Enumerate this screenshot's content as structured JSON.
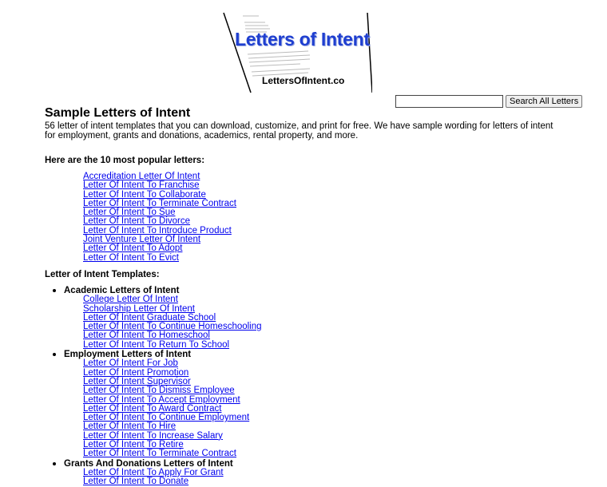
{
  "banner": {
    "title": "Letters of Intent",
    "site": "LettersOfIntent.co"
  },
  "search": {
    "value": "",
    "button_label": "Search All Letters"
  },
  "page": {
    "title": "Sample Letters of Intent",
    "intro": "56 letter of intent templates that you can download, customize, and print for free. We have sample wording for letters of intent for employment, grants and donations, academics, rental property, and more.",
    "popular_heading": "Here are the 10 most popular letters:",
    "templates_heading": "Letter of Intent Templates:"
  },
  "popular": [
    "Accreditation Letter Of Intent",
    "Letter Of Intent To Franchise",
    "Letter Of Intent To Collaborate",
    "Letter Of Intent To Terminate Contract",
    "Letter Of Intent To Sue",
    "Letter Of Intent To Divorce",
    "Letter Of Intent To Introduce Product",
    "Joint Venture Letter Of Intent",
    "Letter Of Intent To Adopt",
    "Letter Of Intent To Evict"
  ],
  "categories": [
    {
      "name": "Academic Letters of Intent",
      "items": [
        "College Letter Of Intent",
        "Scholarship Letter Of Intent",
        "Letter Of Intent Graduate School",
        "Letter Of Intent To Continue Homeschooling",
        "Letter Of Intent To Homeschool",
        "Letter Of Intent To Return To School"
      ]
    },
    {
      "name": "Employment Letters of Intent",
      "items": [
        "Letter Of Intent For Job",
        "Letter Of Intent Promotion",
        "Letter Of Intent Supervisor",
        "Letter Of Intent To Dismiss Employee",
        "Letter Of Intent To Accept Employment",
        "Letter Of Intent To Award Contract",
        "Letter Of Intent To Continue Employment",
        "Letter Of Intent To Hire",
        "Letter Of Intent To Increase Salary",
        "Letter Of Intent To Retire",
        "Letter Of Intent To Terminate Contract"
      ]
    },
    {
      "name": "Grants And Donations Letters of Intent",
      "items": [
        "Letter Of Intent To Apply For Grant",
        "Letter Of Intent To Donate"
      ]
    }
  ],
  "colors": {
    "link": "#0000ee",
    "banner_title": "#1f3fd0"
  }
}
